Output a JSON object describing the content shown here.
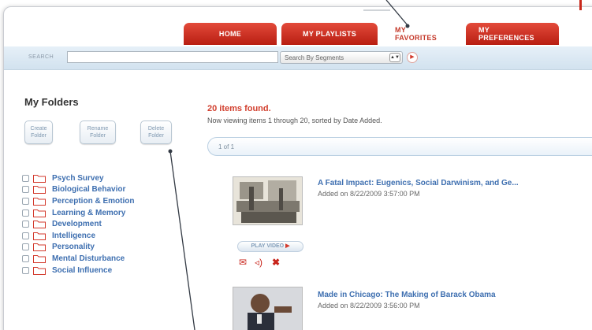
{
  "nav": {
    "tabs": [
      {
        "label": "HOME"
      },
      {
        "label": "MY PLAYLISTS"
      },
      {
        "label": "MY FAVORITES"
      },
      {
        "label": "MY PREFERENCES"
      }
    ],
    "active_tab": "MY FAVORITES"
  },
  "search": {
    "label": "SEARCH",
    "input_value": "",
    "segment_select": "Search By Segments"
  },
  "sidebar": {
    "title": "My Folders",
    "buttons": {
      "create": "Create Folder",
      "rename": "Rename Folder",
      "delete": "Delete Folder"
    },
    "folders": [
      "Psych Survey",
      "Biological Behavior",
      "Perception & Emotion",
      "Learning & Memory",
      "Development",
      "Intelligence",
      "Personality",
      "Mental Disturbance",
      "Social Influence"
    ]
  },
  "results": {
    "found": "20 items found.",
    "viewing": "Now viewing items 1 through 20, sorted by Date Added.",
    "pager": "1 of 1",
    "items": [
      {
        "title": "A Fatal Impact: Eugenics, Social Darwinism, and Ge...",
        "added": "Added on 8/22/2009 3:57:00 PM",
        "play_label": "PLAY VIDEO"
      },
      {
        "title": "Made in Chicago: The Making of Barack Obama",
        "added": "Added on 8/22/2009 3:56:00 PM"
      }
    ]
  },
  "colors": {
    "tab_red": "#c8281b",
    "link_blue": "#3e6fb0",
    "found_red": "#d2402f",
    "search_band": "#dbe8f3"
  },
  "icons": [
    "folder-icon",
    "checkbox",
    "play-arrow-icon",
    "email-icon",
    "speaker-icon",
    "delete-x-icon",
    "select-arrows-icon",
    "go-arrow-icon"
  ]
}
